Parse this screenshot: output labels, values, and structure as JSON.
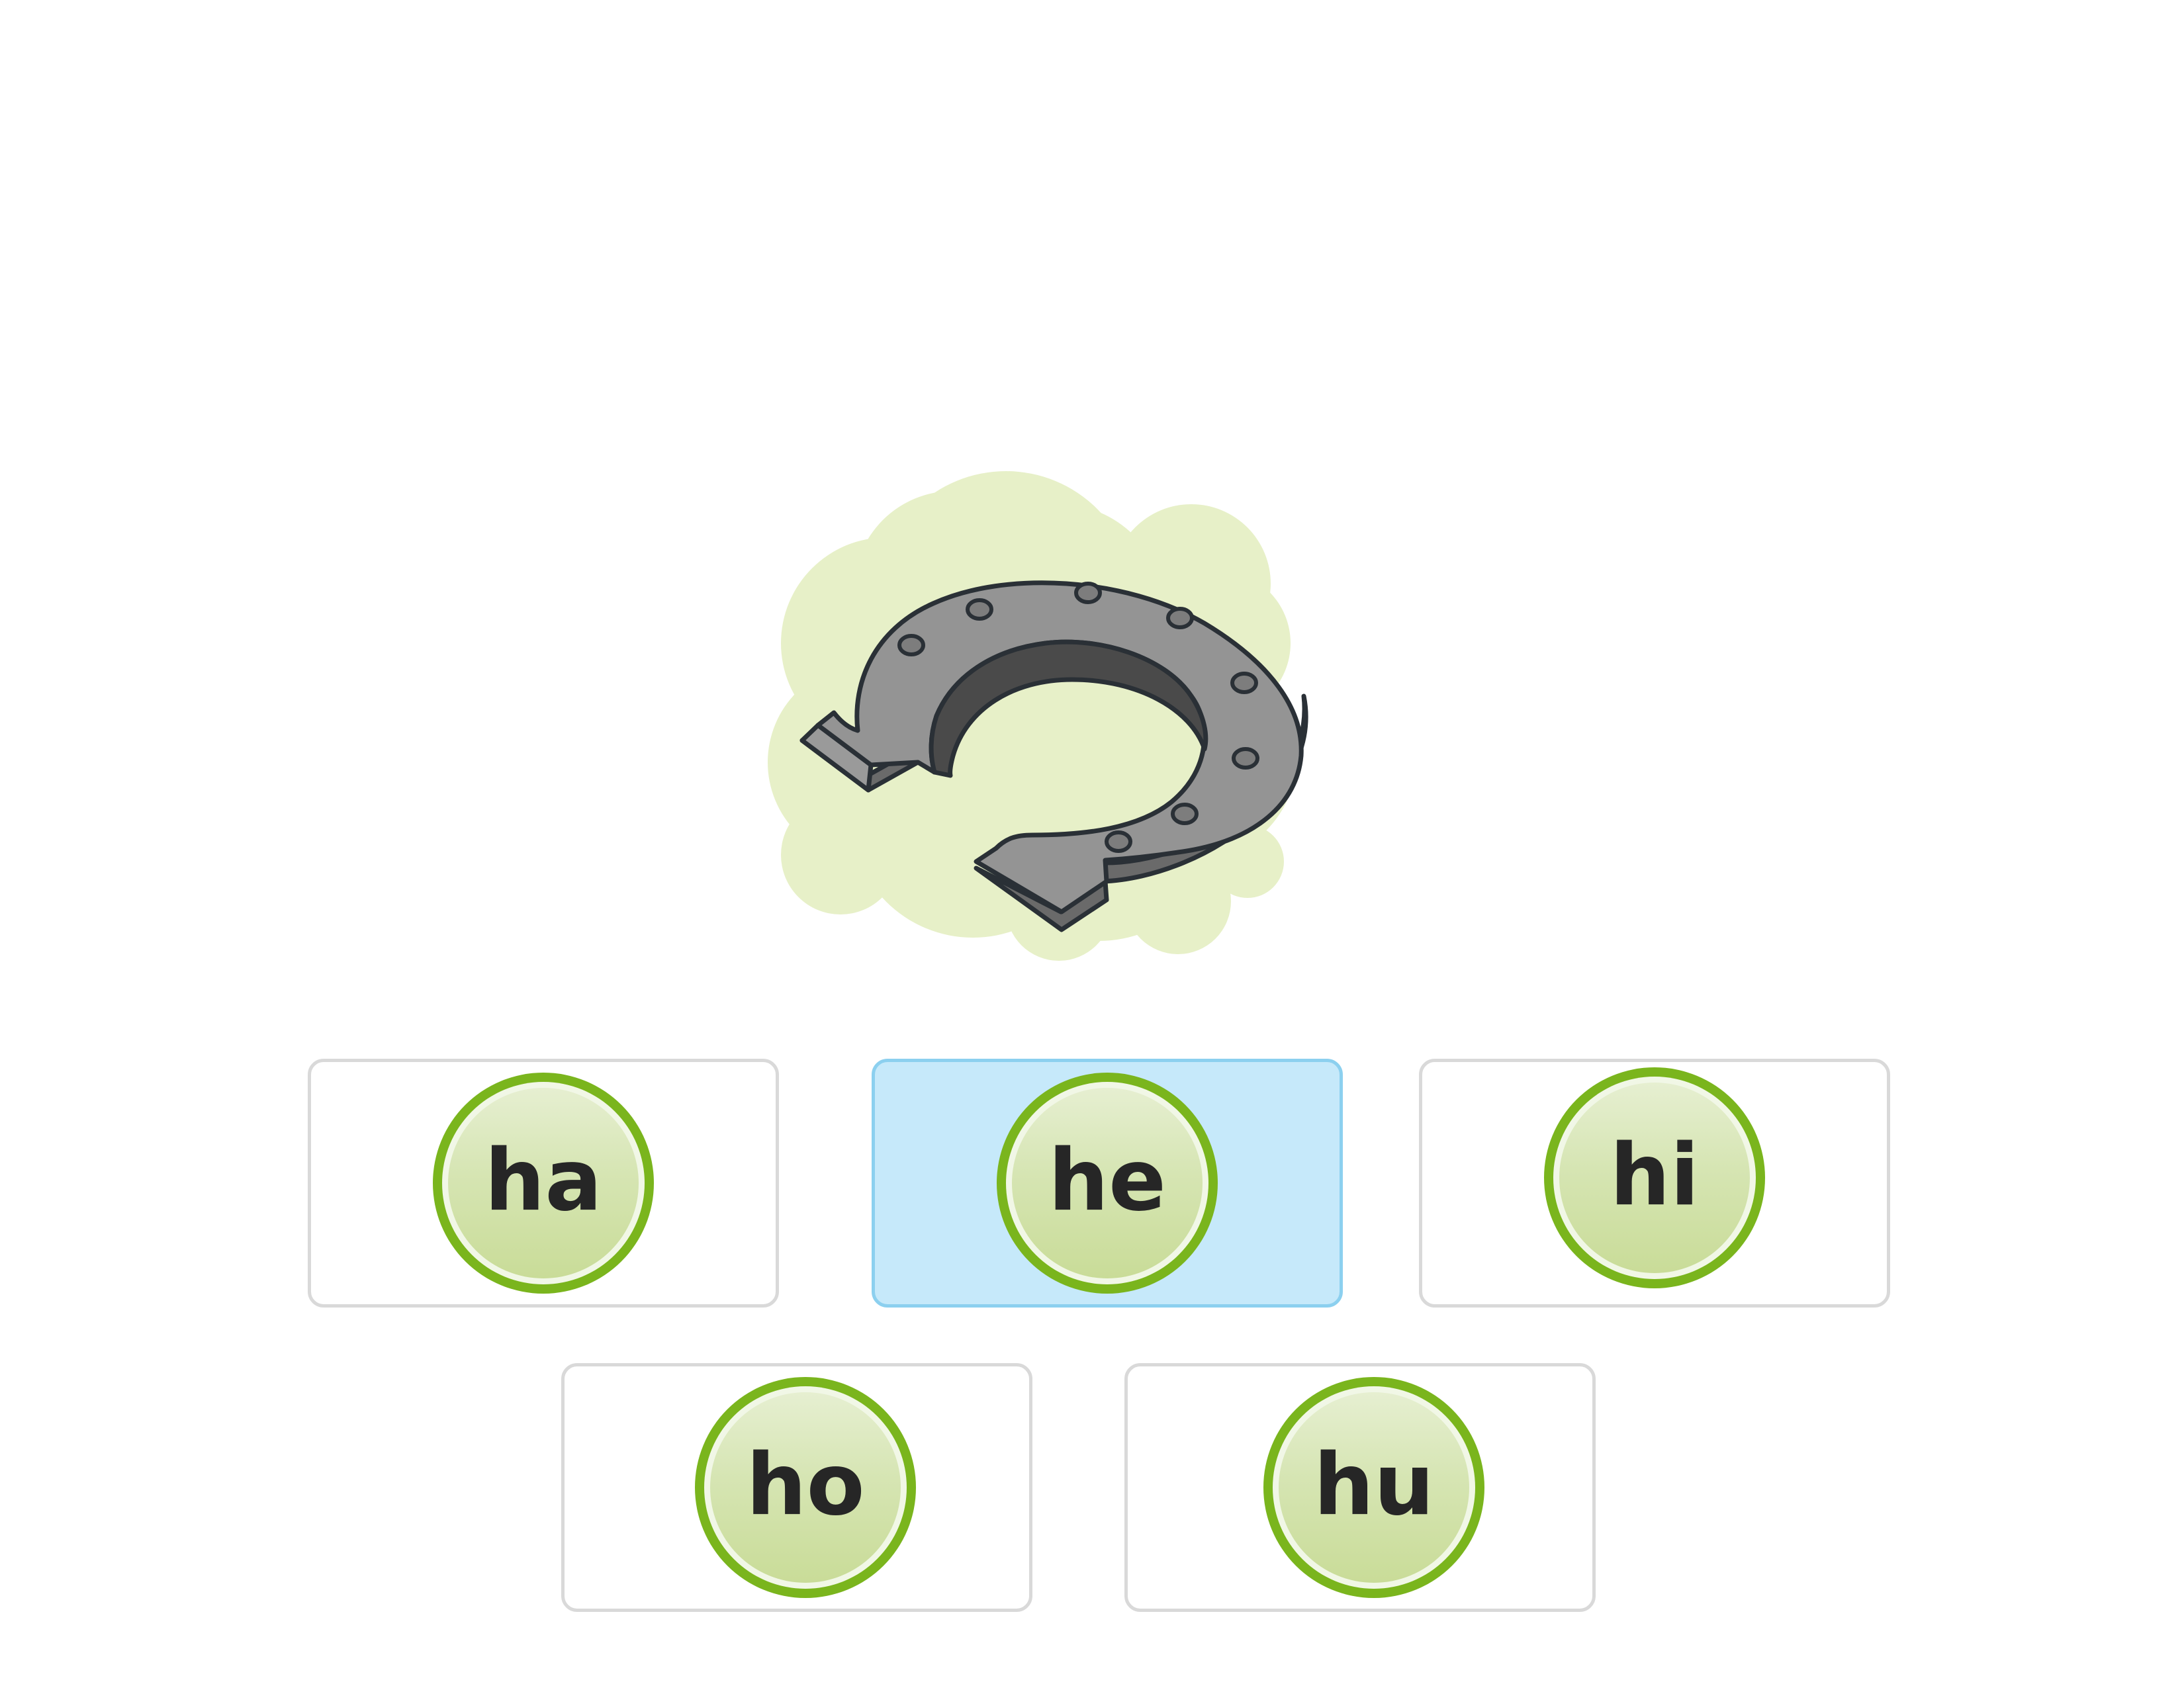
{
  "picture": {
    "subject": "horseshoe",
    "icon": "horseshoe-icon",
    "backdrop_color": "#e7f0c8",
    "metal_color": "#8e8e8e"
  },
  "options": [
    {
      "label": "ha",
      "selected": false
    },
    {
      "label": "he",
      "selected": true
    },
    {
      "label": "hi",
      "selected": false
    },
    {
      "label": "ho",
      "selected": false
    },
    {
      "label": "hu",
      "selected": false
    }
  ],
  "colors": {
    "accent_green": "#7ab51d",
    "selected_fill": "#c6e9fa",
    "selected_border": "#8cd0ef",
    "card_border": "#d9d9d9"
  }
}
